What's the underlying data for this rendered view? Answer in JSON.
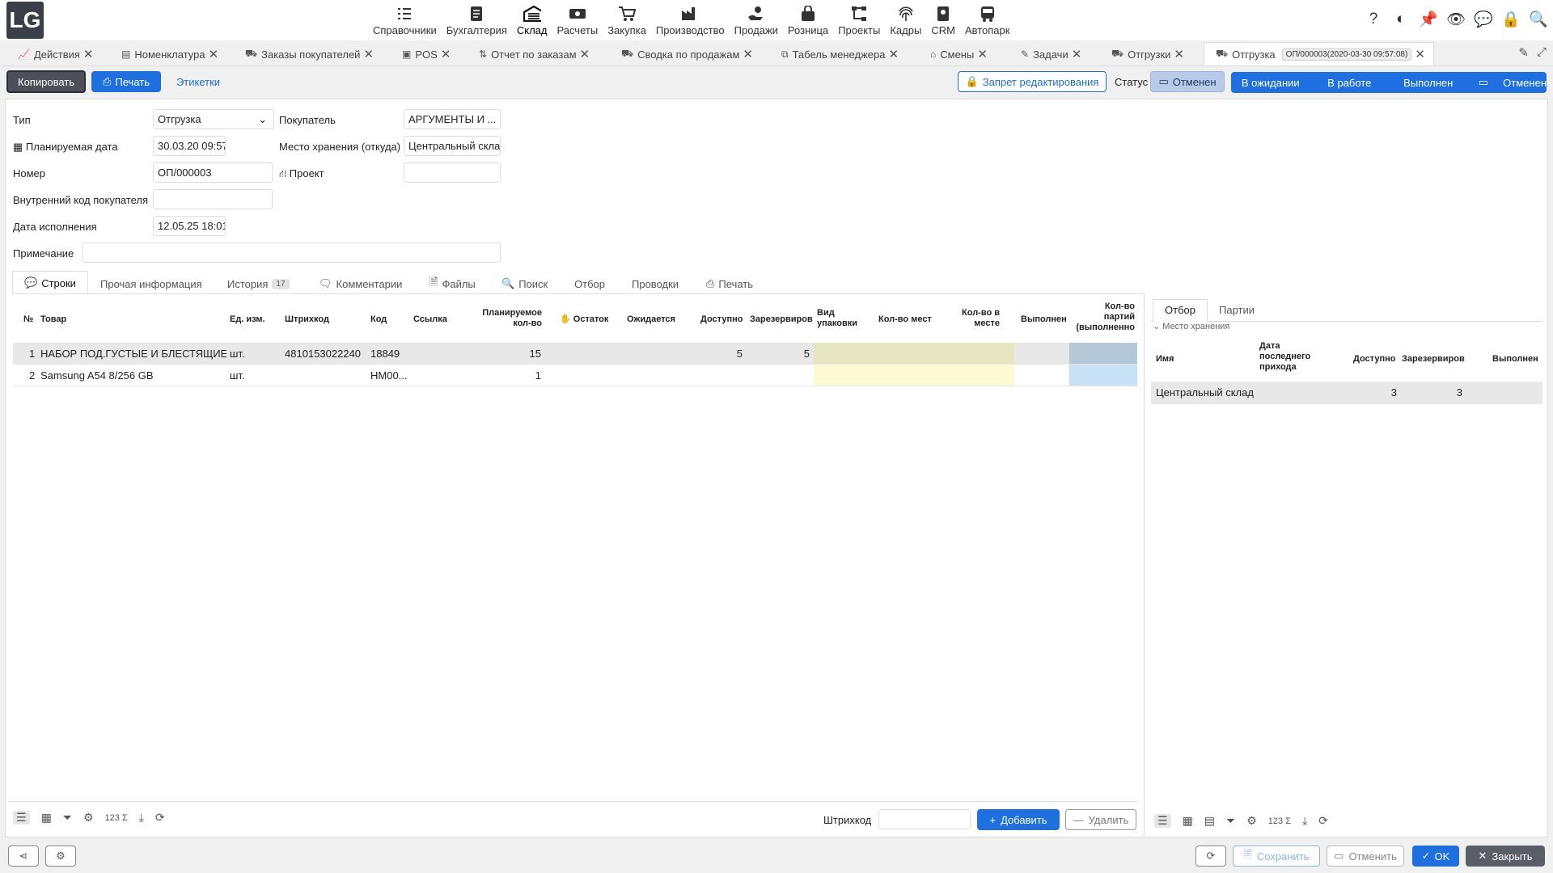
{
  "app": {
    "logo": "LG"
  },
  "modules": [
    {
      "label": "Справочники",
      "icon": "list-check-icon"
    },
    {
      "label": "Бухгалтерия",
      "icon": "ledger-icon"
    },
    {
      "label": "Склад",
      "icon": "warehouse-icon"
    },
    {
      "label": "Расчеты",
      "icon": "cash-icon"
    },
    {
      "label": "Закупка",
      "icon": "cart-icon"
    },
    {
      "label": "Производство",
      "icon": "factory-icon"
    },
    {
      "label": "Продажи",
      "icon": "hand-coin-icon"
    },
    {
      "label": "Розница",
      "icon": "bag-icon"
    },
    {
      "label": "Проекты",
      "icon": "tree-icon"
    },
    {
      "label": "Кадры",
      "icon": "fingerprint-icon"
    },
    {
      "label": "CRM",
      "icon": "contact-icon"
    },
    {
      "label": "Автопарк",
      "icon": "bus-icon"
    }
  ],
  "top_icons": [
    "help-icon",
    "contrast-icon",
    "pin-icon",
    "eye-icon",
    "chat-icon",
    "lock-icon",
    "search-icon"
  ],
  "tabs": [
    {
      "label": "Действия",
      "icon": "chart-line-icon"
    },
    {
      "label": "Номенклатура",
      "icon": "catalog-icon"
    },
    {
      "label": "Заказы покупателей",
      "icon": "person-dolly-icon"
    },
    {
      "label": "POS",
      "icon": "pos-icon"
    },
    {
      "label": "Отчет по заказам",
      "icon": "sort-icon"
    },
    {
      "label": "Сводка по продажам",
      "icon": "person-dolly-icon"
    },
    {
      "label": "Табель менеджера",
      "icon": "copy-icon"
    },
    {
      "label": "Смены",
      "icon": "shift-icon"
    },
    {
      "label": "Задачи",
      "icon": "edit-icon"
    },
    {
      "label": "Отгрузки",
      "icon": "truck-icon"
    },
    {
      "label": "Отгрузка",
      "icon": "truck-icon",
      "docnum": "ОП/000003(2020-03-30 09:57:08)"
    }
  ],
  "toolbar": {
    "copy": "Копировать",
    "print": "Печать",
    "labels": "Этикетки",
    "lock_edit": "Запрет редактирования",
    "status_label": "Статус",
    "status_current": "Отменен",
    "statuses": [
      "В ожидании",
      "В работе",
      "Выполнен",
      "Отменен"
    ]
  },
  "form": {
    "type_label": "Тип",
    "type_value": "Отгрузка",
    "date_label": "Планируемая дата",
    "date_value": "30.03.20 09:57",
    "number_label": "Номер",
    "number_value": "ОП/000003",
    "inner_code_label": "Внутренний код покупателя",
    "inner_code_value": "",
    "exec_date_label": "Дата исполнения",
    "exec_date_value": "12.05.25 18:01",
    "note_label": "Примечание",
    "note_value": "",
    "buyer_label": "Покупатель",
    "buyer_value": "АРГУМЕНТЫ И ...",
    "storage_label": "Место хранения (откуда)",
    "storage_value": "Центральный скла",
    "project_label": "Проект",
    "project_value": ""
  },
  "inner_tabs": [
    {
      "label": "Строки"
    },
    {
      "label": "Прочая информация"
    },
    {
      "label": "История",
      "badge": "17"
    },
    {
      "label": "Комментарии"
    },
    {
      "label": "Файлы"
    },
    {
      "label": "Поиск"
    },
    {
      "label": "Отбор"
    },
    {
      "label": "Проводки"
    },
    {
      "label": "Печать"
    }
  ],
  "grid": {
    "headers": {
      "num": "№",
      "item": "Товар",
      "unit": "Ед. изм.",
      "barcode": "Штрихкод",
      "code": "Код",
      "link": "Ссылка",
      "planned": "Планируемое кол-во",
      "rest": "Остаток",
      "expected": "Ожидается",
      "available": "Доступно",
      "reserved": "Зарезервиров",
      "pack": "Вид упаковки",
      "places": "Кол-во мест",
      "per_place": "Кол-во в месте",
      "done": "Выполнен",
      "batches": "Кол-во партий (выполненно"
    },
    "rows": [
      {
        "num": "1",
        "item": "НАБОР ПОД.ГУСТЫЕ И БЛЕСТЯЩИЕ ...",
        "unit": "шт.",
        "barcode": "4810153022240",
        "code": "18849",
        "planned": "15",
        "available": "5",
        "reserved": "5"
      },
      {
        "num": "2",
        "item": "Samsung A54 8/256 GB",
        "unit": "шт.",
        "barcode": "",
        "code": "HM00...",
        "planned": "1",
        "available": "",
        "reserved": ""
      }
    ],
    "barcode_label": "Штрихкод",
    "add": "Добавить",
    "delete": "Удалить",
    "sum_label": "123"
  },
  "right_panel": {
    "tabs": [
      "Отбор",
      "Партии"
    ],
    "group": "Место хранения",
    "headers": {
      "name": "Имя",
      "last_date": "Дата последнего прихода",
      "available": "Доступно",
      "reserved": "Зарезервиров",
      "done": "Выполнен"
    },
    "rows": [
      {
        "name": "Центральный склад",
        "available": "3",
        "reserved": "3"
      }
    ]
  },
  "footer": {
    "save": "Сохранить",
    "cancel": "Отменить",
    "ok": "OK",
    "close": "Закрыть"
  },
  "colors": {
    "accent": "#1e6fe0",
    "yellow": "#fdfbd4",
    "blue_cell": "#c9e1f5"
  }
}
